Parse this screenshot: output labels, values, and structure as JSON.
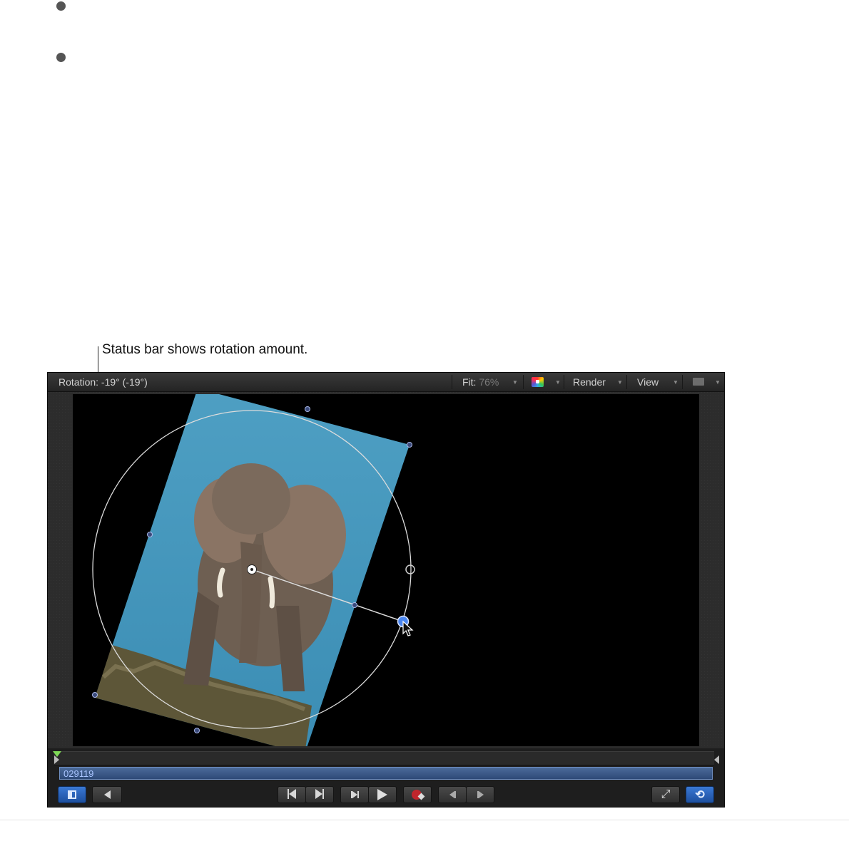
{
  "callout": {
    "text": "Status bar shows rotation amount."
  },
  "statusbar": {
    "rotation_text": "Rotation: -19° (-19°)",
    "fit_label": "Fit:",
    "fit_value": "76%",
    "render_label": "Render",
    "view_label": "View",
    "color_icon": "color-channels-icon",
    "layout_icon": "layout-icon"
  },
  "viewer": {
    "rotation_degrees": -19,
    "image_description_icon": "elephant-image",
    "rotation_handle_color": "#4a86f0"
  },
  "mini_timeline": {
    "clip_label": "029119"
  },
  "controls": {
    "left": [
      "toggle-timeline-icon",
      "audio-icon"
    ],
    "transport": [
      "go-to-start-icon",
      "go-to-end-icon",
      "play-from-start-icon",
      "play-icon",
      "record-icon",
      "previous-frame-icon",
      "next-frame-icon"
    ],
    "right": [
      "full-screen-icon",
      "loop-icon"
    ]
  },
  "colors": {
    "accent": "#2f6fd1",
    "record": "#c0262d",
    "playhead": "#7ed957"
  }
}
